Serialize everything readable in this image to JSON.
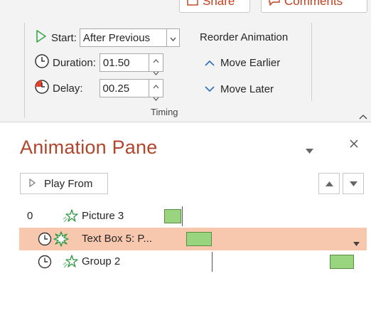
{
  "ribbon": {
    "share_label": "Share",
    "comments_label": "Comments",
    "start_label": "Start:",
    "start_value": "After Previous",
    "duration_label": "Duration:",
    "duration_value": "01.50",
    "delay_label": "Delay:",
    "delay_value": "00.25",
    "reorder_label": "Reorder Animation",
    "move_earlier_label": "Move Earlier",
    "move_later_label": "Move Later",
    "group_label": "Timing"
  },
  "pane": {
    "title": "Animation Pane",
    "play_from_label": "Play From",
    "items": [
      {
        "number": "0",
        "label": "Picture 3"
      },
      {
        "number": "",
        "label": "Text Box 5: P..."
      },
      {
        "number": "",
        "label": "Group 2"
      }
    ]
  },
  "colors": {
    "accent": "#c43e1c",
    "title": "#b0462c",
    "selected_row": "#f8c8ae",
    "bar_fill": "#99d47e",
    "green_icon": "#3aa64b"
  }
}
